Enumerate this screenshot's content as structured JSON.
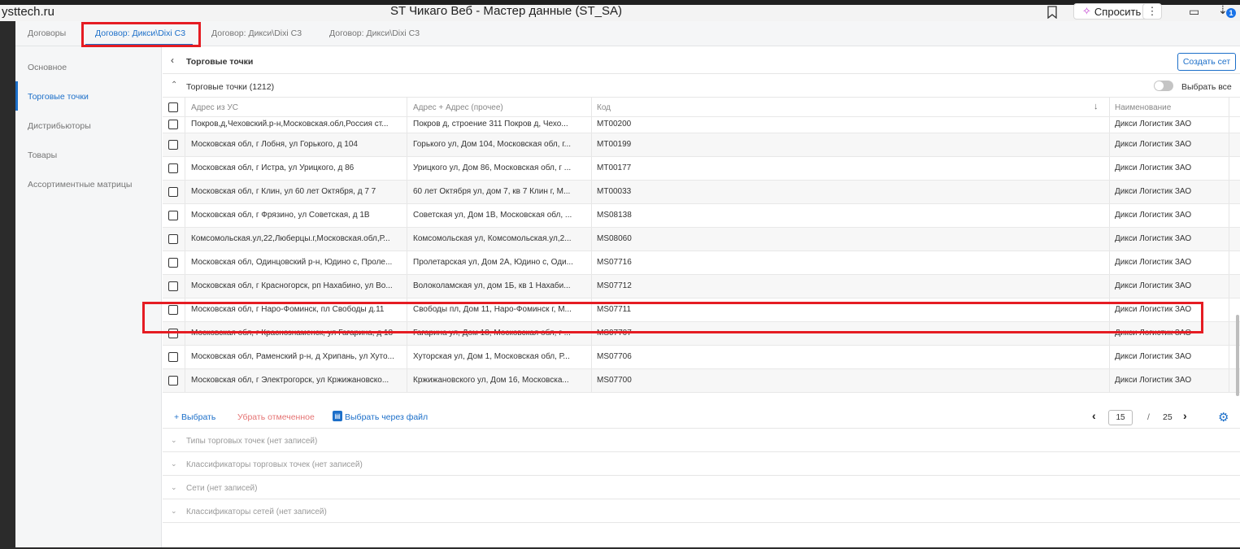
{
  "window": {
    "host_fragment": "ysttech.ru",
    "title": "ST Чикаго Веб - Мастер данные (ST_SA)",
    "ask_label": "Спросить",
    "more_label": "⋮",
    "notification_count": "1"
  },
  "tabs": [
    {
      "label": "Договоры"
    },
    {
      "label": "Договор: Дикси\\Dixi C3"
    },
    {
      "label": "Договор: Дикси\\Dixi C3"
    },
    {
      "label": "Договор: Дикси\\Dixi C3"
    }
  ],
  "sidebar": {
    "items": [
      {
        "label": "Основное"
      },
      {
        "label": "Торговые точки"
      },
      {
        "label": "Дистрибьюторы"
      },
      {
        "label": "Товары"
      },
      {
        "label": "Ассортиментные матрицы"
      }
    ]
  },
  "header": {
    "title": "Торговые точки",
    "create_button": "Создать сет"
  },
  "section": {
    "title": "Торговые точки (1212)",
    "select_all": "Выбрать все"
  },
  "table": {
    "columns": [
      "Адрес из УС",
      "Адрес + Адрес (прочее)",
      "Код",
      "Наименование"
    ],
    "rows": [
      {
        "a": "Покров,д,Чеховский.р-н,Московская.обл,Россия ст...",
        "b": "Покров д, строение 311 Покров д, Чехо...",
        "code": "MT00200",
        "name": "Дикси Логистик ЗАО"
      },
      {
        "a": "Московская обл, г Лобня, ул Горького, д 104",
        "b": "Горького ул, Дом 104, Московская обл, г...",
        "code": "MT00199",
        "name": "Дикси Логистик ЗАО"
      },
      {
        "a": "Московская обл, г Истра, ул Урицкого, д 86",
        "b": "Урицкого ул, Дом 86, Московская обл, г ...",
        "code": "MT00177",
        "name": "Дикси Логистик ЗАО"
      },
      {
        "a": "Московская обл, г Клин, ул 60 лет Октября, д 7 7",
        "b": "60 лет Октября ул, дом 7, кв 7 Клин г, М...",
        "code": "MT00033",
        "name": "Дикси Логистик ЗАО"
      },
      {
        "a": "Московская обл, г Фрязино, ул Советская, д 1В",
        "b": "Советская ул, Дом 1В, Московская обл, ...",
        "code": "MS08138",
        "name": "Дикси Логистик ЗАО"
      },
      {
        "a": "Комсомольская.ул,22,Люберцы.г,Московская.обл,Р...",
        "b": "Комсомольская ул, Комсомольская.ул,2...",
        "code": "MS08060",
        "name": "Дикси Логистик ЗАО"
      },
      {
        "a": "Московская обл, Одинцовский р-н, Юдино с, Проле...",
        "b": "Пролетарская ул, Дом 2А, Юдино с, Оди...",
        "code": "MS07716",
        "name": "Дикси Логистик ЗАО"
      },
      {
        "a": "Московская обл, г Красногорск, рп Нахабино, ул Во...",
        "b": "Волоколамская ул, дом 1Б, кв 1 Нахаби...",
        "code": "MS07712",
        "name": "Дикси Логистик ЗАО"
      },
      {
        "a": "Московская обл, г Наро-Фоминск, пл Свободы д.11",
        "b": "Свободы пл, Дом 11, Наро-Фоминск г, М...",
        "code": "MS07711",
        "name": "Дикси Логистик ЗАО"
      },
      {
        "a": "Московская обл, г Краснознаменск, ул Гагарина, д 18",
        "b": "Гагарина ул, Дом 18, Московская обл, г ...",
        "code": "MS07707",
        "name": "Дикси Логистик ЗАО"
      },
      {
        "a": "Московская обл, Раменский р-н, д Хрипань, ул Хуто...",
        "b": "Хуторская ул, Дом 1, Московская обл, Р...",
        "code": "MS07706",
        "name": "Дикси Логистик ЗАО"
      },
      {
        "a": "Московская обл, г Электрогорск, ул Кржижановско...",
        "b": "Кржижановского ул, Дом 16, Московска...",
        "code": "MS07700",
        "name": "Дикси Логистик ЗАО"
      }
    ]
  },
  "footer": {
    "add": "+ Выбрать",
    "remove": "Убрать отмеченное",
    "from_file": "Выбрать через файл",
    "page": "15",
    "sep": "/",
    "total_pages": "25"
  },
  "accordions": [
    {
      "label": "Типы торговых точек (нет записей)"
    },
    {
      "label": "Классификаторы торговых точек (нет записей)"
    },
    {
      "label": "Сети (нет записей)"
    },
    {
      "label": "Классификаторы сетей (нет записей)"
    }
  ],
  "colors": {
    "accent": "#1c6fc9",
    "highlight": "#e51c23",
    "danger_text": "#e57373"
  }
}
